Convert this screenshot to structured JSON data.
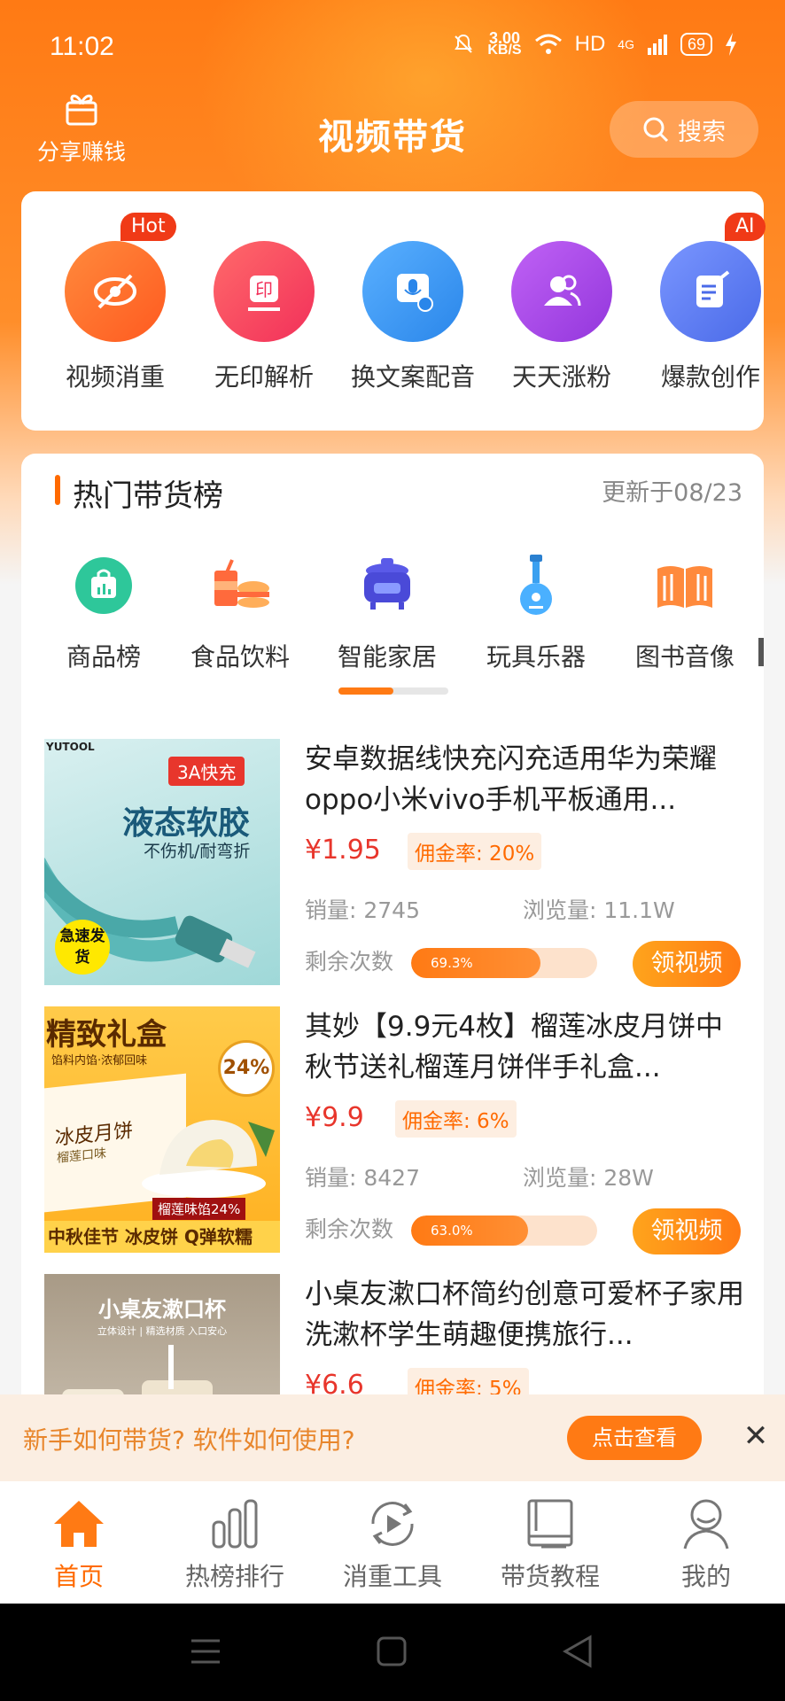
{
  "status": {
    "time": "11:02",
    "speed_value": "3.00",
    "speed_unit": "KB/S",
    "network": "HD",
    "signal": "4G",
    "battery": "69"
  },
  "header": {
    "share_label": "分享赚钱",
    "title": "视频带货",
    "search_label": "搜索"
  },
  "tools": [
    {
      "label": "视频消重",
      "badge": "Hot",
      "color": "#ff6a2c",
      "icon": "eye-off-icon"
    },
    {
      "label": "无印解析",
      "badge": "",
      "color": "#f7405a",
      "icon": "stamp-icon"
    },
    {
      "label": "换文案配音",
      "badge": "",
      "color": "#3a94f0",
      "icon": "microphone-icon"
    },
    {
      "label": "天天涨粉",
      "badge": "",
      "color": "#a445e6",
      "icon": "users-icon"
    },
    {
      "label": "爆款创作",
      "badge": "AI",
      "color": "#5a7cf2",
      "icon": "document-edit-icon"
    }
  ],
  "hot": {
    "title": "热门带货榜",
    "updated": "更新于08/23",
    "categories": [
      {
        "label": "商品榜",
        "icon": "bag-chart-icon"
      },
      {
        "label": "食品饮料",
        "icon": "food-drink-icon"
      },
      {
        "label": "智能家居",
        "icon": "rice-cooker-icon"
      },
      {
        "label": "玩具乐器",
        "icon": "guitar-icon"
      },
      {
        "label": "图书音像",
        "icon": "book-icon"
      }
    ],
    "products": [
      {
        "title": "安卓数据线快充闪充适用华为荣耀oppo小米vivo手机平板通用...",
        "price": "¥1.95",
        "commission": "佣金率: 20%",
        "sales": "销量: 2745",
        "views": "浏览量: 11.1W",
        "remain_label": "剩余次数",
        "remain_pct": 69.3,
        "remain_text": "69.3%",
        "button": "领视频",
        "thumb": {
          "brand": "YUTOOL",
          "tag": "3A快充",
          "headline": "液态软胶",
          "sub": "不伤机/耐弯折",
          "stamp": "急速发货"
        }
      },
      {
        "title": "其妙【9.9元4枚】榴莲冰皮月饼中秋节送礼榴莲月饼伴手礼盒...",
        "price": "¥9.9",
        "commission": "佣金率: 6%",
        "sales": "销量: 8427",
        "views": "浏览量: 28W",
        "remain_label": "剩余次数",
        "remain_pct": 63.0,
        "remain_text": "63.0%",
        "button": "领视频",
        "thumb": {
          "headline": "精致礼盒",
          "sub": "馅料内馅·浓郁回味",
          "pct": "24%",
          "box": "冰皮月饼",
          "box_sub": "榴莲口味",
          "tag": "榴莲味馅24%",
          "bottom": "中秋佳节 冰皮饼 Q弹软糯"
        }
      },
      {
        "title": "小桌友漱口杯简约创意可爱杯子家用洗漱杯学生萌趣便携旅行...",
        "price": "¥6.6",
        "commission": "佣金率: 5%",
        "sales": "",
        "views": "",
        "remain_label": "",
        "remain_pct": 0,
        "remain_text": "",
        "button": "",
        "thumb": {
          "headline": "小桌友漱口杯",
          "sub": "立体设计 | 精选材质 入口安心"
        }
      }
    ]
  },
  "notice": {
    "text": "新手如何带货? 软件如何使用?",
    "button": "点击查看",
    "close": "✕"
  },
  "nav": [
    {
      "label": "首页",
      "icon": "home-icon",
      "active": true
    },
    {
      "label": "热榜排行",
      "icon": "bar-chart-icon",
      "active": false
    },
    {
      "label": "消重工具",
      "icon": "play-refresh-icon",
      "active": false
    },
    {
      "label": "带货教程",
      "icon": "book-open-icon",
      "active": false
    },
    {
      "label": "我的",
      "icon": "user-icon",
      "active": false
    }
  ],
  "colors": {
    "brand": "#ff7a14",
    "price": "#e8362c"
  }
}
